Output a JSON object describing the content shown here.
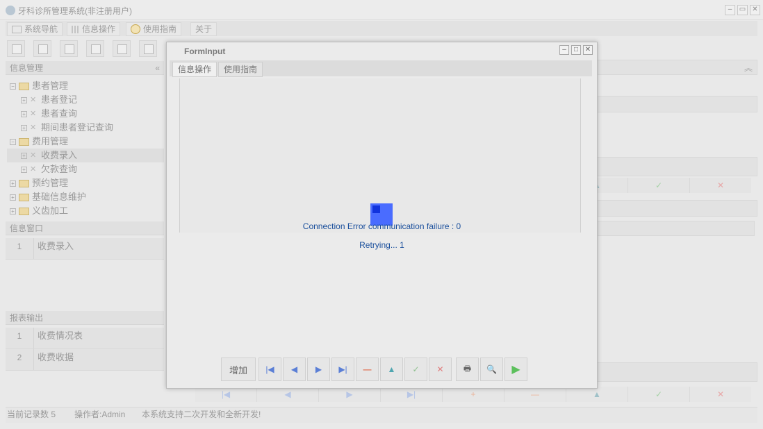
{
  "app": {
    "title": "牙科诊所管理系统(非注册用户)",
    "window_buttons": [
      "–",
      "▭",
      "✕"
    ]
  },
  "menu": [
    {
      "label": "系统导航",
      "icon": "monitor-icon"
    },
    {
      "label": "信息操作",
      "icon": "grid-icon"
    },
    {
      "label": "使用指南",
      "icon": "clock-icon"
    },
    {
      "label": "关于",
      "icon": ""
    }
  ],
  "left_panel": {
    "info_mgmt_title": "信息管理",
    "collapse_glyph": "«",
    "tree": [
      {
        "label": "患者管理",
        "level": 0,
        "kind": "folder",
        "expander": "⊟"
      },
      {
        "label": "患者登记",
        "level": 1,
        "kind": "tool",
        "expander": "⊞"
      },
      {
        "label": "患者查询",
        "level": 1,
        "kind": "tool",
        "expander": "⊞"
      },
      {
        "label": "期间患者登记查询",
        "level": 1,
        "kind": "tool",
        "expander": "⊞"
      },
      {
        "label": "费用管理",
        "level": 0,
        "kind": "folder",
        "expander": "⊟"
      },
      {
        "label": "收费录入",
        "level": 1,
        "kind": "tool",
        "expander": "⊞",
        "selected": true
      },
      {
        "label": "欠款查询",
        "level": 1,
        "kind": "tool",
        "expander": "⊞"
      },
      {
        "label": "预约管理",
        "level": 0,
        "kind": "folder",
        "expander": "⊞"
      },
      {
        "label": "基础信息维护",
        "level": 0,
        "kind": "folder",
        "expander": "⊞"
      },
      {
        "label": "义齿加工",
        "level": 0,
        "kind": "folder",
        "expander": "⊞"
      }
    ],
    "info_window_title": "信息窗口",
    "info_window_rows": [
      {
        "num": "1",
        "label": "收费录入"
      }
    ],
    "report_title": "报表输出",
    "report_rows": [
      {
        "num": "1",
        "label": "收费情况表"
      },
      {
        "num": "2",
        "label": "收费收据"
      }
    ]
  },
  "background_nav": [
    "|◀",
    "◀",
    "▶",
    "▶|",
    "+",
    "—",
    "▲",
    "✓",
    "✕"
  ],
  "status": {
    "record_count": "当前记录数 5",
    "operator": "操作者:Admin",
    "message": "本系统支持二次开发和全新开发!"
  },
  "dialog": {
    "title": "FormInput",
    "buttons": [
      "–",
      "□",
      "✕"
    ],
    "tabs": [
      "信息操作",
      "使用指南"
    ],
    "error_line1": "Connection Error communication failure : 0",
    "error_line2": "Retrying... 1",
    "toolbar": {
      "add": "增加",
      "first": "|◀",
      "prev": "◀",
      "next": "▶",
      "last": "▶|",
      "delete": "—",
      "edit": "▲",
      "confirm": "✓",
      "cancel": "✕",
      "print": "🖶",
      "preview": "🔍",
      "run": "▶"
    }
  },
  "colors": {
    "loader": "#4a6cff",
    "error_text": "#1a4f9c",
    "nav_blue": "#5b7fd6",
    "delete_red": "#e07050",
    "confirm_green": "#6cc06c",
    "run_green": "#5cc05c"
  }
}
